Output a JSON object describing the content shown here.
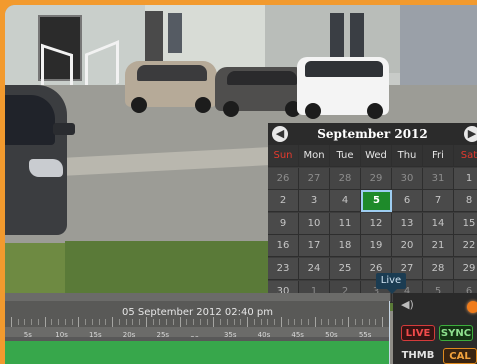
{
  "calendar": {
    "month_title": "September  2012",
    "prev_glyph": "◀",
    "next_glyph": "▶",
    "weekdays": [
      "Sun",
      "Mon",
      "Tue",
      "Wed",
      "Thu",
      "Fri",
      "Sat"
    ],
    "weeks": [
      [
        "26",
        "27",
        "28",
        "29",
        "30",
        "31",
        "1"
      ],
      [
        "2",
        "3",
        "4",
        "5",
        "6",
        "7",
        "8"
      ],
      [
        "9",
        "10",
        "11",
        "12",
        "13",
        "14",
        "15"
      ],
      [
        "16",
        "17",
        "18",
        "19",
        "20",
        "21",
        "22"
      ],
      [
        "23",
        "24",
        "25",
        "26",
        "27",
        "28",
        "29"
      ],
      [
        "30",
        "1",
        "2",
        "3",
        "4",
        "5",
        "6"
      ]
    ],
    "selected_day": "5",
    "weekend_color": "#e23a2e",
    "selected_color": "#1e8a2a"
  },
  "tooltip": {
    "live_label": "Live"
  },
  "timeline": {
    "datetime": "05 September 2012 02:40 pm",
    "labels": [
      "5s",
      "10s",
      "15s",
      "20s",
      "25s",
      "30s",
      "35s",
      "40s",
      "45s",
      "50s",
      "55s"
    ],
    "track_color": "#37a74b"
  },
  "controls": {
    "live_label": "LIVE",
    "sync_label": "SYNC",
    "thumb_label": "THMB",
    "cal_label": "CAL",
    "volume_icon": "speaker-icon",
    "status_icon": "record-indicator-icon"
  }
}
